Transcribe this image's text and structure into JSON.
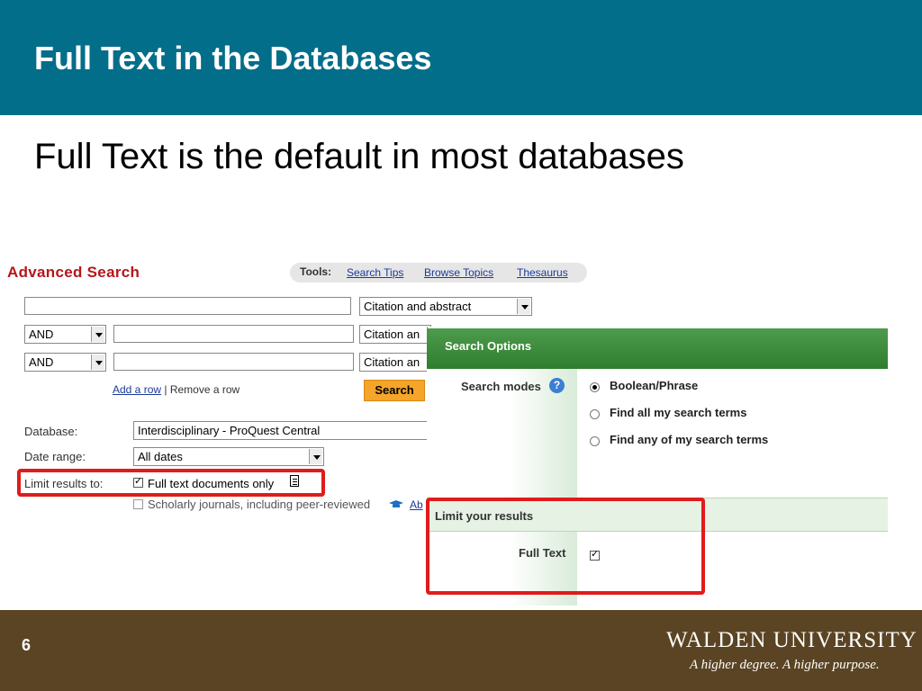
{
  "slide": {
    "title": "Full Text in the Databases",
    "subtitle": "Full Text is the default in most databases",
    "page_number": "6",
    "header_color": "#036e8a",
    "footer_color": "#5a4423"
  },
  "advanced_search": {
    "title": "Advanced Search",
    "tools_label": "Tools:",
    "tools_links": [
      "Search Tips",
      "Browse Topics",
      "Thesaurus"
    ],
    "rows": [
      {
        "operator": "",
        "term": "",
        "field": "Citation and abstract"
      },
      {
        "operator": "AND",
        "term": "",
        "field": "Citation an"
      },
      {
        "operator": "AND",
        "term": "",
        "field": "Citation an"
      }
    ],
    "add_row": "Add a row",
    "separator": "|",
    "remove_row": "Remove a row",
    "search_button": "Search",
    "database_label": "Database:",
    "database_value": "Interdisciplinary - ProQuest Central",
    "date_range_label": "Date range:",
    "date_range_value": "All dates",
    "limit_label": "Limit results to:",
    "full_text_option": "Full text documents only",
    "full_text_checked": true,
    "scholarly_option": "Scholarly journals, including peer-reviewed",
    "scholarly_checked": false,
    "scholarly_link_fragment": "Ab"
  },
  "search_options": {
    "title": "Search Options",
    "modes_label": "Search modes",
    "help_glyph": "?",
    "modes": [
      {
        "label": "Boolean/Phrase",
        "selected": true
      },
      {
        "label": "Find all my search terms",
        "selected": false
      },
      {
        "label": "Find any of my search terms",
        "selected": false
      }
    ],
    "limit_title": "Limit your results",
    "full_text_label": "Full Text",
    "full_text_checked": true,
    "header_color": "#3b8a3a"
  },
  "footer": {
    "logo_text": "WALDEN UNIVERSITY",
    "tagline": "A higher degree. A higher purpose."
  },
  "colors": {
    "highlight_box": "#e01b1b",
    "search_button": "#f4a52a",
    "advanced_title": "#b5161b"
  }
}
